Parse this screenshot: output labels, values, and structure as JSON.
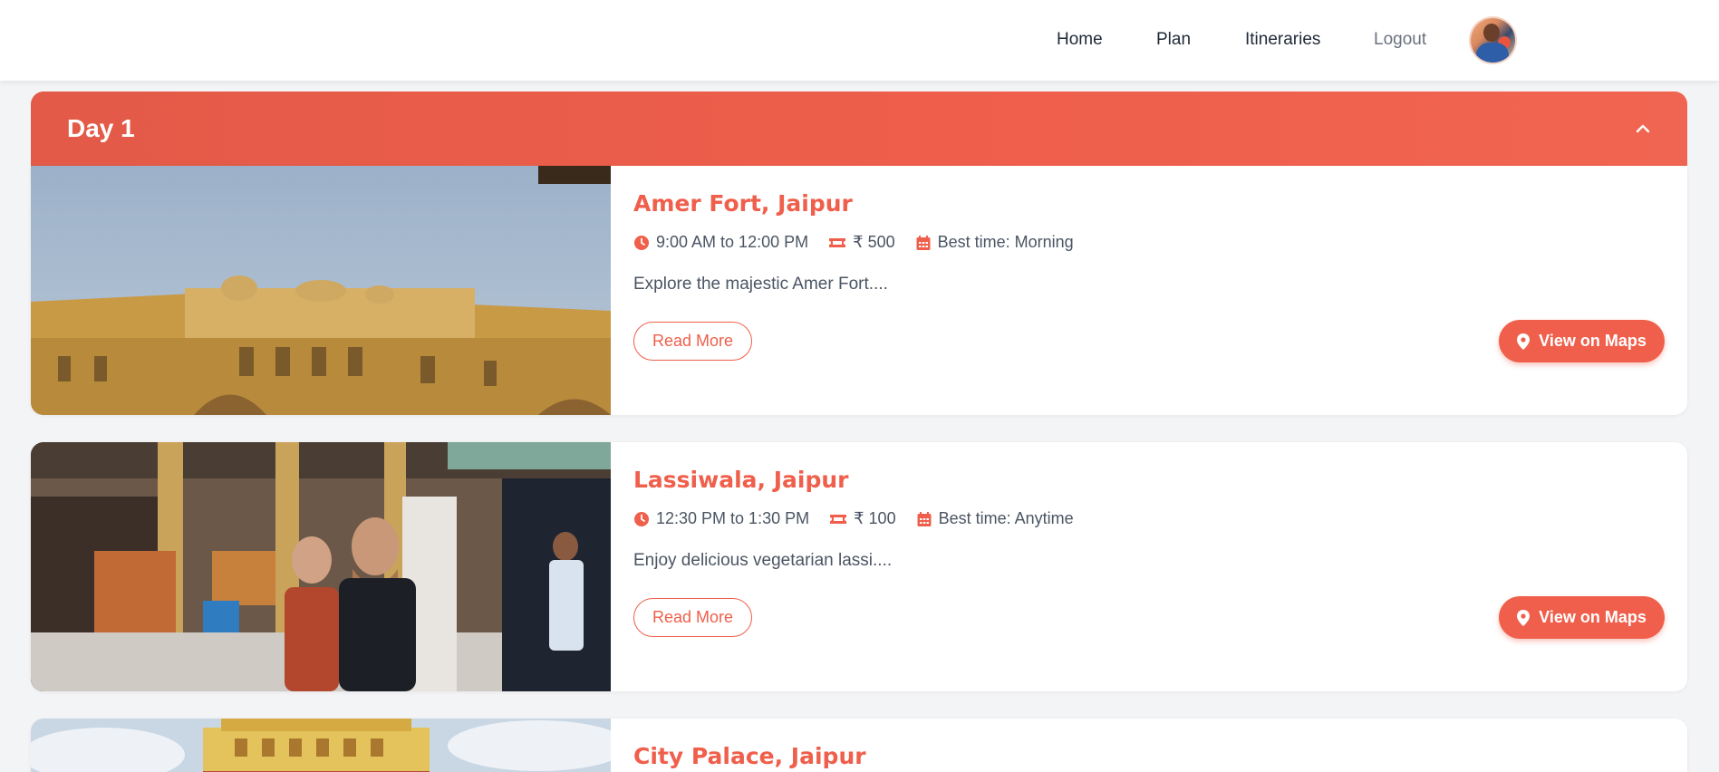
{
  "nav": {
    "links": [
      "Home",
      "Plan",
      "Itineraries",
      "Logout"
    ]
  },
  "day": {
    "title": "Day 1"
  },
  "colors": {
    "accent": "#ef5f4b",
    "background": "#f3f4f6"
  },
  "places": [
    {
      "title": "Amer Fort, Jaipur",
      "time": "9:00 AM to 12:00 PM",
      "price": "₹ 500",
      "best_time": "Best time: Morning",
      "description": "Explore the majestic Amer Fort....",
      "read_more": "Read More",
      "maps": "View on Maps"
    },
    {
      "title": "Lassiwala, Jaipur",
      "time": "12:30 PM to 1:30 PM",
      "price": "₹ 100",
      "best_time": "Best time: Anytime",
      "description": "Enjoy delicious vegetarian lassi....",
      "read_more": "Read More",
      "maps": "View on Maps"
    },
    {
      "title": "City Palace, Jaipur"
    }
  ],
  "icons": [
    "clock-icon",
    "ticket-icon",
    "calendar-icon",
    "map-pin-icon",
    "chevron-up-icon"
  ]
}
